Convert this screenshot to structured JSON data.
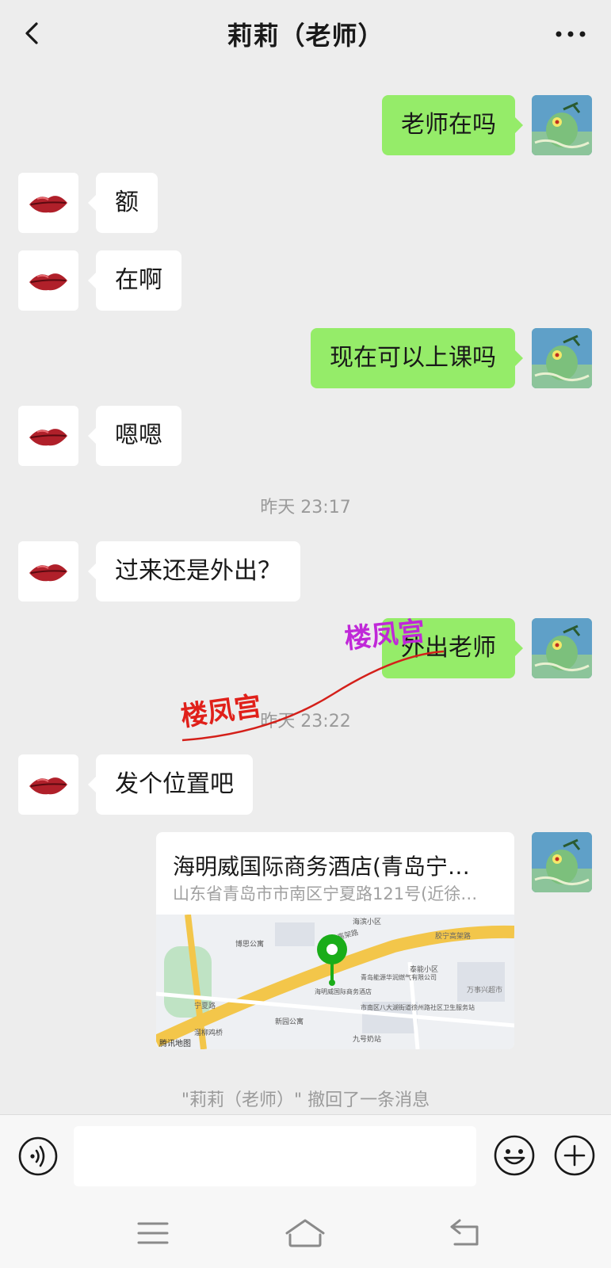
{
  "header": {
    "title": "莉莉（老师）"
  },
  "messages": [
    {
      "from": "me",
      "text": "老师在吗"
    },
    {
      "from": "her",
      "text": "额"
    },
    {
      "from": "her",
      "text": "在啊"
    },
    {
      "from": "me",
      "text": "现在可以上课吗"
    },
    {
      "from": "her",
      "text": "嗯嗯"
    },
    {
      "from": "her",
      "text": "过来还是外出？"
    },
    {
      "from": "me",
      "text": "外出老师"
    },
    {
      "from": "her",
      "text": "发个位置吧"
    }
  ],
  "timestamps": [
    "昨天 23:17",
    "昨天 23:22"
  ],
  "location": {
    "name": "海明威国际商务酒店(青岛宁…",
    "address": "山东省青岛市市南区宁夏路121号(近徐…",
    "map_labels": {
      "haibin": "海滨小区",
      "bosi": "博思公寓",
      "jiaoning1": "胶宁高架路",
      "jiaoning2": "胶宁高架路",
      "taineng": "泰能小区",
      "gas": "青岛能源华润燃气有限公司",
      "hotel": "海明威国际商务酒店",
      "health": "市南区八大湖街道徐州路社区卫生服务站",
      "wanshi": "万事兴超市",
      "ningxia": "宁夏路",
      "xinyuan": "新园公寓",
      "liuyu": "溜柳鸡桥",
      "jiuhao": "九号奶站",
      "tencent": "腾讯地图"
    }
  },
  "recall_text": "\"莉莉（老师）\" 撤回了一条消息",
  "watermark": {
    "text_left": "楼凤宫",
    "text_right": "楼凤宫"
  },
  "input": {
    "placeholder": ""
  },
  "colors": {
    "my_bubble": "#95ec69",
    "her_bubble": "#ffffff",
    "background": "#ededed",
    "map_pin": "#1aad19"
  }
}
